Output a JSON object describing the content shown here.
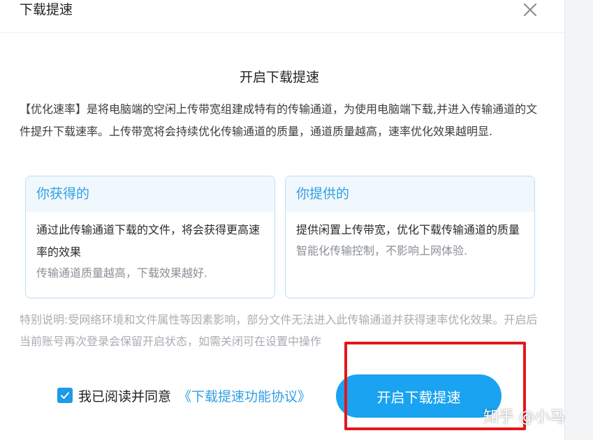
{
  "dialog": {
    "title": "下载提速",
    "close_icon": "close-icon",
    "headline": "开启下载提速",
    "intro": "【优化速率】是将电脑端的空闲上传带宽组建成特有的传输通道，为使用电脑端下载,并进入传输通道的文件提升下载速率。上传带宽将会持续优化传输通道的质量，通道质量越高，速率优化效果越明显.",
    "cards": [
      {
        "title": "你获得的",
        "main": "通过此传输通道下载的文件，将会获得更高速率的效果",
        "sub": "传输通道质量越高，下载效果越好."
      },
      {
        "title": "你提供的",
        "main": "提供闲置上传带宽，优化下载传输通道的质量",
        "sub": "智能化传输控制，不影响上网体验."
      }
    ],
    "note": "特别说明:受网络环境和文件属性等因素影响，部分文件无法进入此传输通道并获得速率优化效果。开启后当前账号再次登录会保留开启状态，如需关闭可在设置中操作",
    "agreement": {
      "checked": true,
      "checkbox_icon": "checkmark-icon",
      "label": "我已阅读并同意",
      "link": "《下载提速功能协议》"
    },
    "primary_button": "开启下载提速"
  },
  "watermark": "知乎 @小马",
  "colors": {
    "accent": "#1aa3f0",
    "link": "#2f9fe3",
    "highlight": "#e6161b",
    "card_border": "#b9dff5",
    "card_header_bg": "#f0f8fd",
    "note_text": "#a8acb2"
  }
}
